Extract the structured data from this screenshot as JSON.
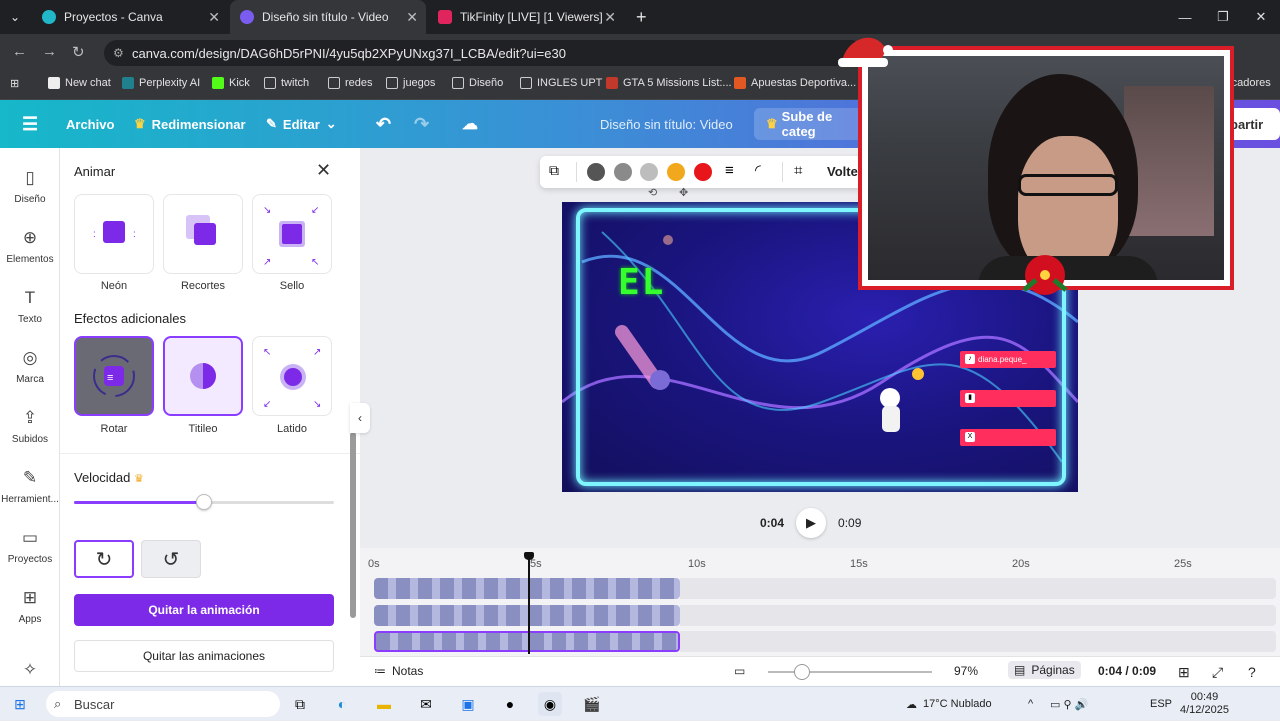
{
  "browser": {
    "tabs": [
      {
        "title": "Proyectos - Canva",
        "active": false
      },
      {
        "title": "Diseño sin título - Video",
        "active": true
      },
      {
        "title": "TikFinity [LIVE] [1 Viewers]",
        "active": false
      }
    ],
    "url": "canva.com/design/DAG6hD5rPNI/4yu5qb2XPyUNxg37I_LCBA/edit?ui=e30",
    "bookmarks": [
      "New chat",
      "Perplexity AI",
      "Kick",
      "twitch",
      "redes",
      "juegos",
      "Diseño",
      "INGLES UPT",
      "GTA 5 Missions List:...",
      "Apuestas Deportiva...",
      "rcadores"
    ]
  },
  "header": {
    "archivo": "Archivo",
    "redimensionar": "Redimensionar",
    "editar": "Editar",
    "design_title": "Diseño sin título: Video",
    "upgrade": "Sube de categ",
    "share": "partir"
  },
  "rail": {
    "items": [
      {
        "label": "Diseño",
        "icon": "layout-icon"
      },
      {
        "label": "Elementos",
        "icon": "shapes-icon"
      },
      {
        "label": "Texto",
        "icon": "text-icon"
      },
      {
        "label": "Marca",
        "icon": "brand-icon"
      },
      {
        "label": "Subidos",
        "icon": "upload-icon"
      },
      {
        "label": "Herramient...",
        "icon": "draw-icon"
      },
      {
        "label": "Proyectos",
        "icon": "folder-icon"
      },
      {
        "label": "Apps",
        "icon": "apps-icon"
      }
    ]
  },
  "panel": {
    "title": "Animar",
    "top_effects": [
      "Neón",
      "Recortes",
      "Sello"
    ],
    "additional_title": "Efectos adicionales",
    "additional_effects": [
      "Rotar",
      "Titileo",
      "Latido"
    ],
    "speed_label": "Velocidad",
    "speed_value": 0.5,
    "remove_animation": "Quitar la animación",
    "remove_animations": "Quitar las animaciones"
  },
  "toolbar": {
    "colors": [
      "#555555",
      "#8a8a8a",
      "#bdbdbd",
      "#f2a81d",
      "#e8161b"
    ],
    "flip_label": "Voltea"
  },
  "canvas": {
    "text": "EL",
    "handle": "diana.peque_"
  },
  "playback": {
    "current": "0:04",
    "total": "0:09"
  },
  "timeline": {
    "ticks": [
      "0s",
      "5s",
      "10s",
      "15s",
      "20s",
      "25s"
    ]
  },
  "status": {
    "notes": "Notas",
    "zoom": "97%",
    "pages": "Páginas",
    "time": "0:04 / 0:09"
  },
  "taskbar": {
    "search": "Buscar",
    "weather": "17°C  Nublado",
    "lang": "ESP",
    "time": "00:49",
    "date": "4/12/2025"
  }
}
